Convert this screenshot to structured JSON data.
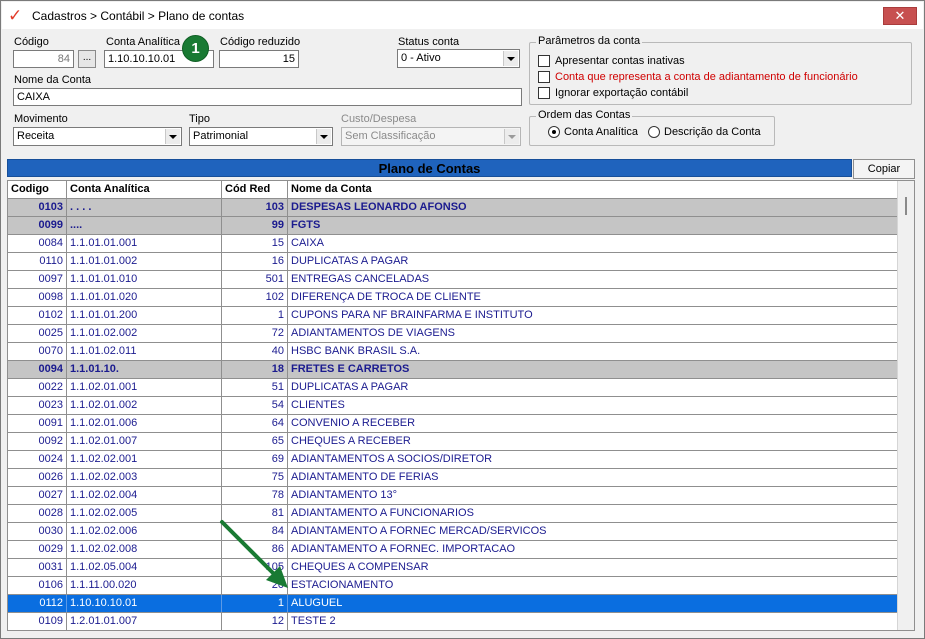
{
  "window": {
    "title": "Cadastros > Contábil > Plano de contas",
    "close_label": "✕"
  },
  "form": {
    "codigo": {
      "label": "Código",
      "value": "84",
      "lookup_label": "..."
    },
    "conta_analitica": {
      "label": "Conta Analítica",
      "value": "1.10.10.10.01"
    },
    "badge": "1",
    "codigo_reduzido": {
      "label": "Código reduzido",
      "value": "15"
    },
    "status_conta": {
      "label": "Status conta",
      "value": "0 - Ativo"
    },
    "nome_da_conta": {
      "label": "Nome da Conta",
      "value": "CAIXA"
    },
    "movimento": {
      "label": "Movimento",
      "value": "Receita"
    },
    "tipo": {
      "label": "Tipo",
      "value": "Patrimonial"
    },
    "custo_despesa": {
      "label": "Custo/Despesa",
      "value": "Sem Classificação"
    }
  },
  "parametros": {
    "title": "Parâmetros da conta",
    "options": [
      {
        "label": "Apresentar contas inativas",
        "checked": false
      },
      {
        "label": "Conta que representa a conta de adiantamento de funcionário",
        "checked": false
      },
      {
        "label": "Ignorar exportação contábil",
        "checked": false
      }
    ]
  },
  "ordem": {
    "title": "Ordem das Contas",
    "options": [
      {
        "label": "Conta Analítica",
        "selected": true
      },
      {
        "label": "Descrição da Conta",
        "selected": false
      }
    ]
  },
  "grid": {
    "title": "Plano de Contas",
    "copy_label": "Copiar",
    "columns": [
      "Codigo",
      "Conta Analítica",
      "Cód Red",
      "Nome da Conta"
    ],
    "rows": [
      {
        "codigo": "0103",
        "conta": ". . . .",
        "cod_red": "103",
        "nome": "DESPESAS LEONARDO AFONSO",
        "kind": "group"
      },
      {
        "codigo": "0099",
        "conta": "....",
        "cod_red": "99",
        "nome": "FGTS",
        "kind": "group"
      },
      {
        "codigo": "0084",
        "conta": "1.1.01.01.001",
        "cod_red": "15",
        "nome": "CAIXA",
        "kind": "normal"
      },
      {
        "codigo": "0110",
        "conta": "1.1.01.01.002",
        "cod_red": "16",
        "nome": "DUPLICATAS A PAGAR",
        "kind": "normal"
      },
      {
        "codigo": "0097",
        "conta": "1.1.01.01.010",
        "cod_red": "501",
        "nome": "ENTREGAS CANCELADAS",
        "kind": "normal"
      },
      {
        "codigo": "0098",
        "conta": "1.1.01.01.020",
        "cod_red": "102",
        "nome": "DIFERENÇA DE TROCA DE CLIENTE",
        "kind": "normal"
      },
      {
        "codigo": "0102",
        "conta": "1.1.01.01.200",
        "cod_red": "1",
        "nome": "CUPONS PARA NF BRAINFARMA E INSTITUTO",
        "kind": "normal"
      },
      {
        "codigo": "0025",
        "conta": "1.1.01.02.002",
        "cod_red": "72",
        "nome": "ADIANTAMENTOS DE VIAGENS",
        "kind": "normal"
      },
      {
        "codigo": "0070",
        "conta": "1.1.01.02.011",
        "cod_red": "40",
        "nome": "HSBC BANK BRASIL S.A.",
        "kind": "normal"
      },
      {
        "codigo": "0094",
        "conta": "1.1.01.10.",
        "cod_red": "18",
        "nome": "FRETES E CARRETOS",
        "kind": "group"
      },
      {
        "codigo": "0022",
        "conta": "1.1.02.01.001",
        "cod_red": "51",
        "nome": "DUPLICATAS A PAGAR",
        "kind": "normal"
      },
      {
        "codigo": "0023",
        "conta": "1.1.02.01.002",
        "cod_red": "54",
        "nome": "CLIENTES",
        "kind": "normal"
      },
      {
        "codigo": "0091",
        "conta": "1.1.02.01.006",
        "cod_red": "64",
        "nome": "CONVENIO A RECEBER",
        "kind": "normal"
      },
      {
        "codigo": "0092",
        "conta": "1.1.02.01.007",
        "cod_red": "65",
        "nome": "CHEQUES A RECEBER",
        "kind": "normal"
      },
      {
        "codigo": "0024",
        "conta": "1.1.02.02.001",
        "cod_red": "69",
        "nome": "ADIANTAMENTOS A SOCIOS/DIRETOR",
        "kind": "normal"
      },
      {
        "codigo": "0026",
        "conta": "1.1.02.02.003",
        "cod_red": "75",
        "nome": "ADIANTAMENTO DE FERIAS",
        "kind": "normal"
      },
      {
        "codigo": "0027",
        "conta": "1.1.02.02.004",
        "cod_red": "78",
        "nome": "ADIANTAMENTO 13°",
        "kind": "normal"
      },
      {
        "codigo": "0028",
        "conta": "1.1.02.02.005",
        "cod_red": "81",
        "nome": "ADIANTAMENTO A FUNCIONARIOS",
        "kind": "normal"
      },
      {
        "codigo": "0030",
        "conta": "1.1.02.02.006",
        "cod_red": "84",
        "nome": "ADIANTAMENTO A FORNEC MERCAD/SERVICOS",
        "kind": "normal"
      },
      {
        "codigo": "0029",
        "conta": "1.1.02.02.008",
        "cod_red": "86",
        "nome": "ADIANTAMENTO A FORNEC. IMPORTACAO",
        "kind": "normal"
      },
      {
        "codigo": "0031",
        "conta": "1.1.02.05.004",
        "cod_red": "105",
        "nome": "CHEQUES A COMPENSAR",
        "kind": "normal"
      },
      {
        "codigo": "0106",
        "conta": "1.1.11.00.020",
        "cod_red": "20",
        "nome": "ESTACIONAMENTO",
        "kind": "normal"
      },
      {
        "codigo": "0112",
        "conta": "1.10.10.10.01",
        "cod_red": "1",
        "nome": "ALUGUEL",
        "kind": "selected"
      },
      {
        "codigo": "0109",
        "conta": "1.2.01.01.007",
        "cod_red": "12",
        "nome": "TESTE 2",
        "kind": "normal"
      }
    ]
  },
  "colors": {
    "accent": "#0a6ee0",
    "header_bar": "#1f63bd",
    "badge": "#197a33",
    "arrow": "#197a33",
    "warning_text": "#d00000"
  },
  "icons": {
    "app": "red-check-logo-icon",
    "close": "close-icon",
    "pointer": "green-arrow-icon"
  }
}
